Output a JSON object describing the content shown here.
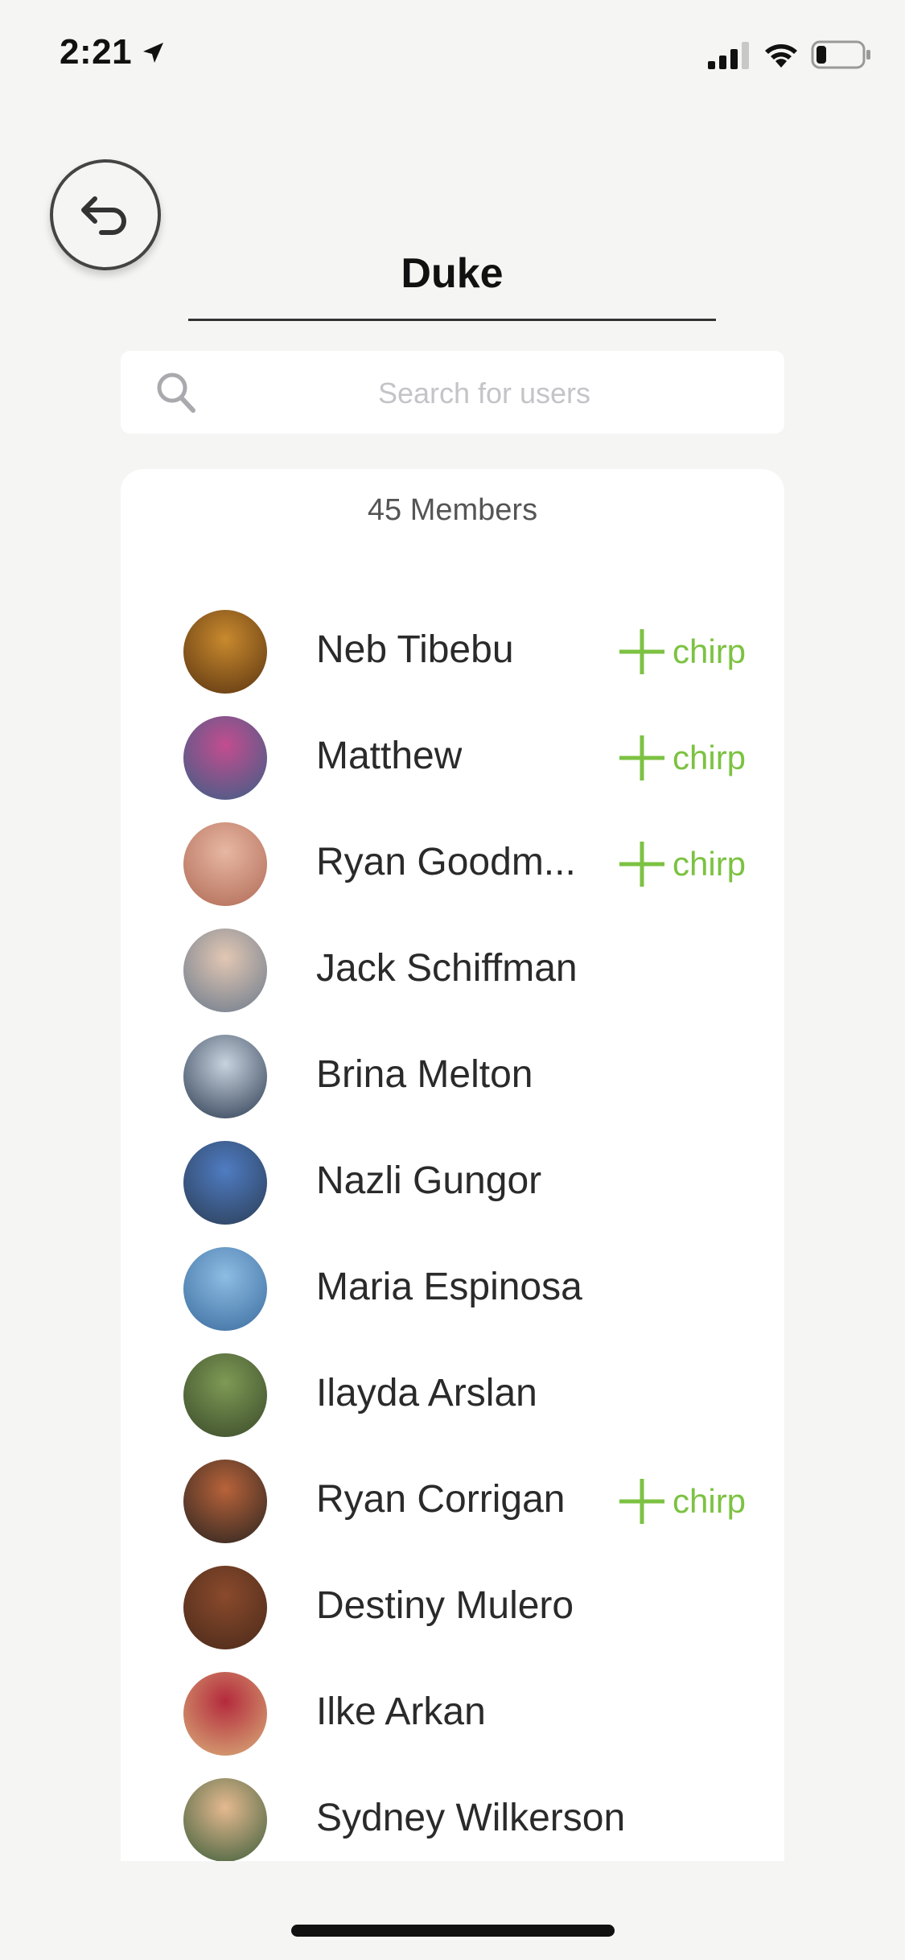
{
  "status_bar": {
    "time": "2:21"
  },
  "header": {
    "title": "Duke"
  },
  "search": {
    "placeholder": "Search for users"
  },
  "members": {
    "count_label": "45 Members",
    "chirp_label": "chirp",
    "items": [
      {
        "name": "Neb Tibebu",
        "has_chirp": true,
        "avatar_colors": [
          "#c98a2e",
          "#5a3410"
        ]
      },
      {
        "name": "Matthew",
        "has_chirp": true,
        "avatar_colors": [
          "#c34d8f",
          "#3b5f86"
        ]
      },
      {
        "name": "Ryan Goodm...",
        "has_chirp": true,
        "avatar_colors": [
          "#e7b7a3",
          "#b06a55"
        ]
      },
      {
        "name": "Jack Schiffman",
        "has_chirp": false,
        "avatar_colors": [
          "#e2c7b3",
          "#6b7a8c"
        ]
      },
      {
        "name": "Brina Melton",
        "has_chirp": false,
        "avatar_colors": [
          "#c7d3de",
          "#2d3b52"
        ]
      },
      {
        "name": "Nazli Gungor",
        "has_chirp": false,
        "avatar_colors": [
          "#4f7cc2",
          "#2b3d56"
        ]
      },
      {
        "name": "Maria Espinosa",
        "has_chirp": false,
        "avatar_colors": [
          "#8dbce3",
          "#3b6c9e"
        ]
      },
      {
        "name": "Ilayda Arslan",
        "has_chirp": false,
        "avatar_colors": [
          "#7e9a55",
          "#3a4a2a"
        ]
      },
      {
        "name": "Ryan Corrigan",
        "has_chirp": true,
        "avatar_colors": [
          "#b8633a",
          "#2a2420"
        ]
      },
      {
        "name": "Destiny Mulero",
        "has_chirp": false,
        "avatar_colors": [
          "#8a4a2c",
          "#4a2a1a"
        ]
      },
      {
        "name": "Ilke Arkan",
        "has_chirp": false,
        "avatar_colors": [
          "#b42a3c",
          "#d9b07a"
        ]
      },
      {
        "name": "Sydney Wilkerson",
        "has_chirp": false,
        "avatar_colors": [
          "#e5b990",
          "#3b5e3a"
        ]
      }
    ]
  },
  "colors": {
    "accent": "#7cc242",
    "background": "#f5f6f4",
    "card": "#ffffff"
  },
  "icons": {
    "back": "undo-arrow-icon",
    "search": "search-icon",
    "chirp": "plus-icon"
  }
}
